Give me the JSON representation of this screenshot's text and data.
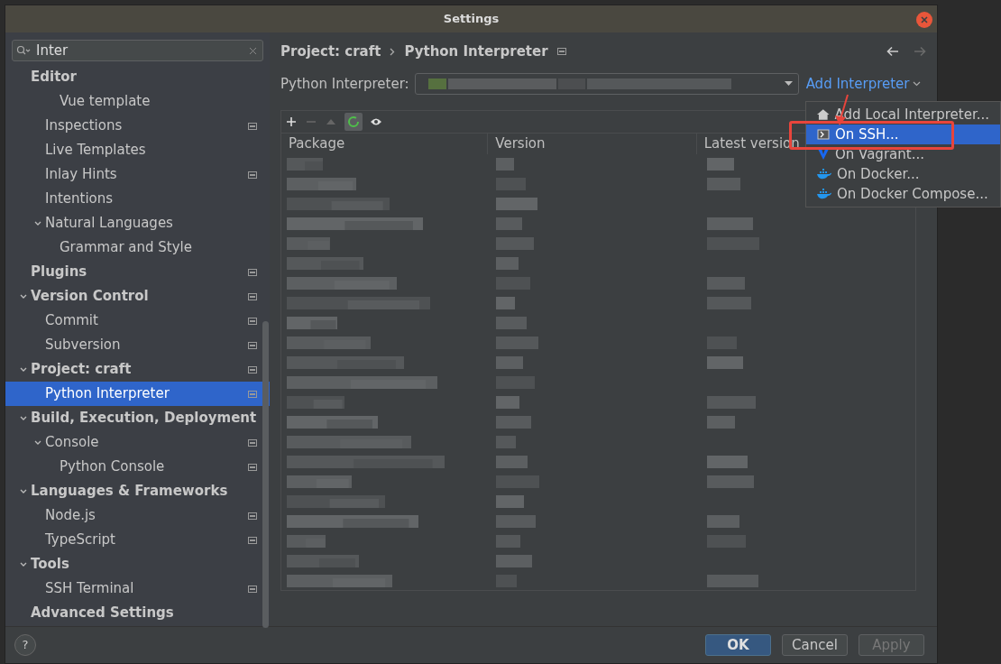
{
  "window": {
    "title": "Settings"
  },
  "search": {
    "value": "Inter"
  },
  "sidebar": {
    "items": [
      {
        "label": "Editor",
        "bold": true,
        "project_icon": false,
        "selected": false,
        "children": [
          {
            "children": [
              {
                "label": "Vue template",
                "bold": false,
                "project_icon": false,
                "selected": false
              }
            ]
          },
          {
            "label": "Inspections",
            "bold": false,
            "project_icon": true,
            "selected": false
          },
          {
            "label": "Live Templates",
            "bold": false,
            "project_icon": false,
            "selected": false
          },
          {
            "label": "Inlay Hints",
            "bold": false,
            "project_icon": true,
            "selected": false
          },
          {
            "label": "Intentions",
            "bold": false,
            "project_icon": false,
            "selected": false
          },
          {
            "label": "Natural Languages",
            "bold": false,
            "project_icon": false,
            "selected": false,
            "expanded": true,
            "children": [
              {
                "label": "Grammar and Style",
                "bold": false,
                "project_icon": false,
                "selected": false
              }
            ]
          }
        ]
      },
      {
        "label": "Plugins",
        "bold": true,
        "project_icon": true,
        "selected": false
      },
      {
        "label": "Version Control",
        "bold": true,
        "project_icon": true,
        "selected": false,
        "expanded": true,
        "children": [
          {
            "label": "Commit",
            "bold": false,
            "project_icon": true,
            "selected": false
          },
          {
            "label": "Subversion",
            "bold": false,
            "project_icon": true,
            "selected": false
          }
        ]
      },
      {
        "label": "Project: craft",
        "bold": true,
        "project_icon": true,
        "selected": false,
        "expanded": true,
        "children": [
          {
            "label": "Python Interpreter",
            "bold": false,
            "project_icon": true,
            "selected": true
          }
        ]
      },
      {
        "label": "Build, Execution, Deployment",
        "bold": true,
        "project_icon": false,
        "selected": false,
        "expanded": true,
        "children": [
          {
            "label": "Console",
            "bold": false,
            "project_icon": true,
            "selected": false,
            "expanded": true,
            "children": [
              {
                "label": "Python Console",
                "bold": false,
                "project_icon": true,
                "selected": false
              }
            ]
          }
        ]
      },
      {
        "label": "Languages & Frameworks",
        "bold": true,
        "project_icon": false,
        "selected": false,
        "expanded": true,
        "children": [
          {
            "label": "Node.js",
            "bold": false,
            "project_icon": true,
            "selected": false
          },
          {
            "label": "TypeScript",
            "bold": false,
            "project_icon": true,
            "selected": false
          }
        ]
      },
      {
        "label": "Tools",
        "bold": true,
        "project_icon": false,
        "selected": false,
        "expanded": true,
        "children": [
          {
            "label": "SSH Terminal",
            "bold": false,
            "project_icon": true,
            "selected": false
          }
        ]
      },
      {
        "label": "Advanced Settings",
        "bold": true,
        "project_icon": false,
        "selected": false
      }
    ]
  },
  "breadcrumb": [
    "Project: craft",
    "Python Interpreter"
  ],
  "interpreter": {
    "label": "Python Interpreter:",
    "add_link": "Add Interpreter"
  },
  "table": {
    "columns": [
      "Package",
      "Version",
      "Latest version"
    ]
  },
  "menu": {
    "items": [
      {
        "label": "Add Local Interpreter...",
        "kind": "home",
        "selected": false
      },
      {
        "label": "On SSH...",
        "kind": "ssh",
        "selected": true
      },
      {
        "label": "On Vagrant...",
        "kind": "vagrant",
        "selected": false
      },
      {
        "label": "On Docker...",
        "kind": "docker",
        "selected": false
      },
      {
        "label": "On Docker Compose...",
        "kind": "docker",
        "selected": false
      }
    ]
  },
  "buttons": [
    {
      "label": "OK",
      "kind": "primary",
      "disabled": false
    },
    {
      "label": "Cancel",
      "kind": "normal",
      "disabled": false
    },
    {
      "label": "Apply",
      "kind": "normal",
      "disabled": true
    }
  ],
  "help": "?"
}
